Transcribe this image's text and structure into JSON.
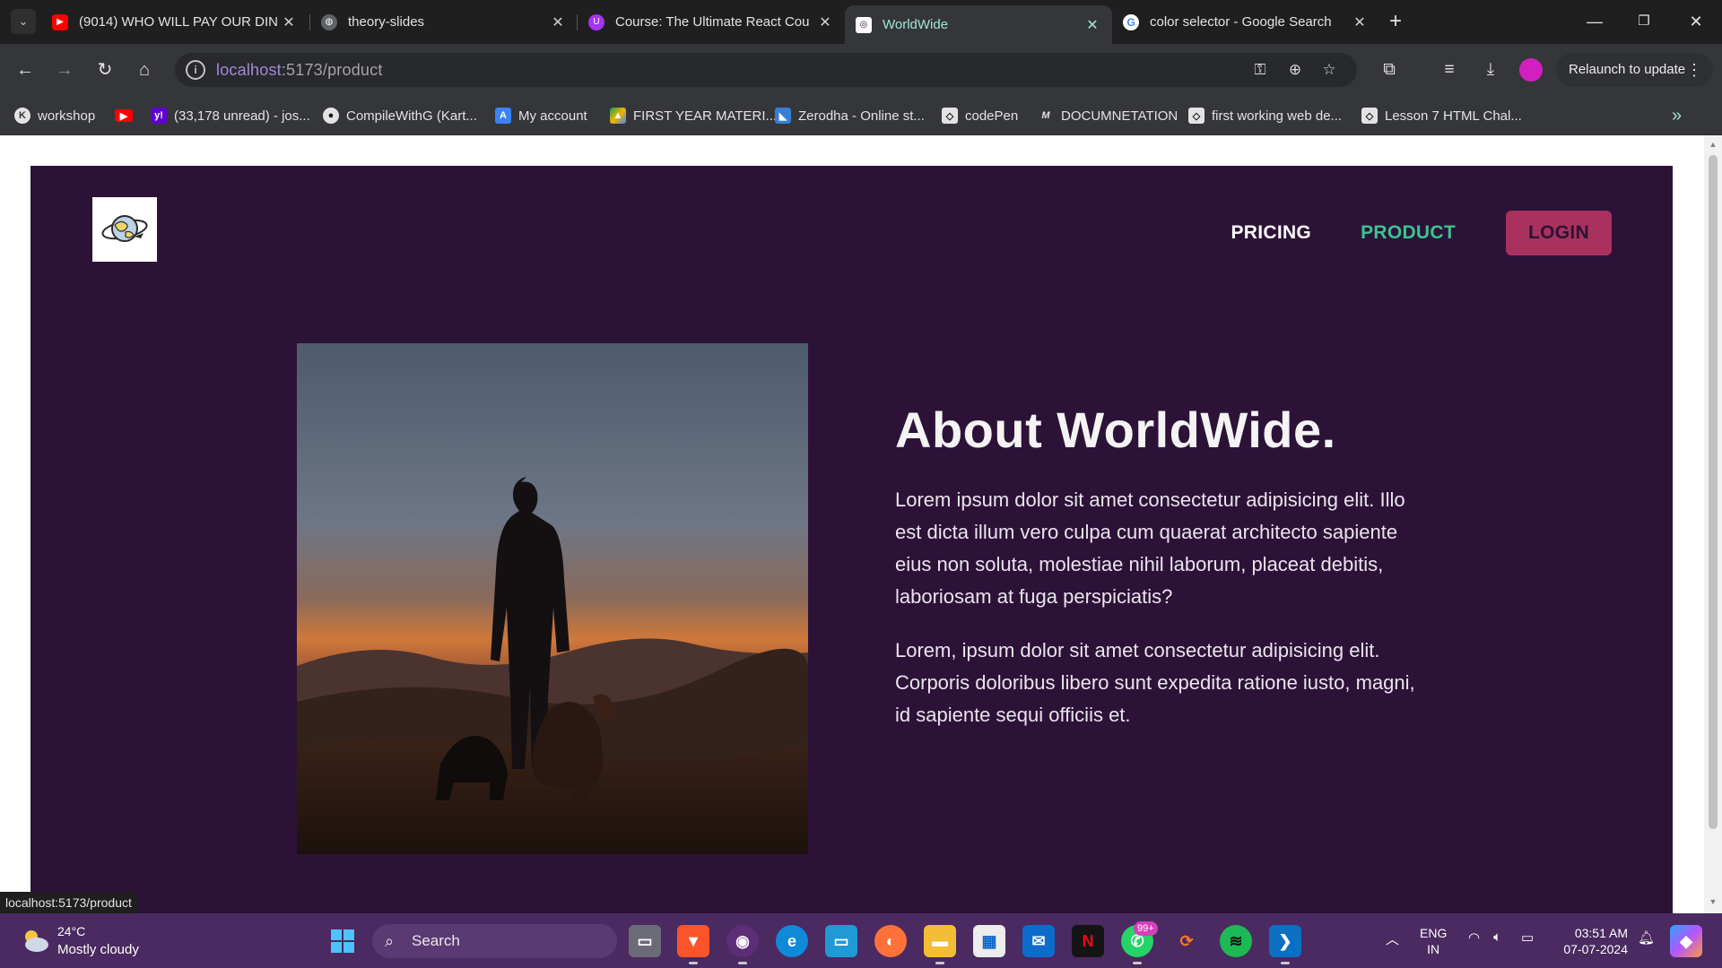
{
  "browser": {
    "tabs": [
      {
        "title": "(9014) WHO WILL PAY OUR DIN",
        "favicon": "youtube-icon",
        "active": false
      },
      {
        "title": "theory-slides",
        "favicon": "globe-icon",
        "active": false
      },
      {
        "title": "Course: The Ultimate React Cou",
        "favicon": "udemy-icon",
        "active": false
      },
      {
        "title": "WorldWide",
        "favicon": "worldwide-favicon",
        "active": true
      },
      {
        "title": "color selector - Google Search",
        "favicon": "google-icon",
        "active": false
      }
    ],
    "url_host": "localhost",
    "url_rest": ":5173/product",
    "relaunch_label": "Relaunch to update",
    "bookmarks": [
      {
        "label": "workshop",
        "icon": "k-icon"
      },
      {
        "label": "",
        "icon": "youtube-icon"
      },
      {
        "label": "(33,178 unread) - jos...",
        "icon": "yahoo-icon"
      },
      {
        "label": "CompileWithG (Kart...",
        "icon": "github-icon"
      },
      {
        "label": "My account",
        "icon": "account-icon"
      },
      {
        "label": "FIRST YEAR MATERI...",
        "icon": "drive-icon"
      },
      {
        "label": "Zerodha - Online st...",
        "icon": "zerodha-icon"
      },
      {
        "label": "codePen",
        "icon": "codepen-icon"
      },
      {
        "label": "DOCUMNETATION",
        "icon": "m-icon"
      },
      {
        "label": "first working web de...",
        "icon": "codepen-icon"
      },
      {
        "label": "Lesson 7 HTML Chal...",
        "icon": "codepen-icon"
      }
    ],
    "status_url": "localhost:5173/product"
  },
  "page": {
    "nav": {
      "pricing": "PRICING",
      "product": "PRODUCT",
      "login": "LOGIN"
    },
    "headline": "About WorldWide.",
    "paragraphs": [
      "Lorem ipsum dolor sit amet consectetur adipisicing elit. Illo est dicta illum vero culpa cum quaerat architecto sapiente eius non soluta, molestiae nihil laborum, placeat debitis, laboriosam at fuga perspiciatis?",
      "Lorem, ipsum dolor sit amet consectetur adipisicing elit. Corporis doloribus libero sunt expedita ratione iusto, magni, id sapiente sequi officiis et."
    ],
    "colors": {
      "background": "#2d1238",
      "active_link": "#3ac48f",
      "login_button": "#a8325d"
    }
  },
  "taskbar": {
    "weather_temp": "24°C",
    "weather_desc": "Mostly cloudy",
    "search_placeholder": "Search",
    "whatsapp_badge": "99+",
    "lang_line1": "ENG",
    "lang_line2": "IN",
    "time": "03:51 AM",
    "date": "07-07-2024"
  }
}
